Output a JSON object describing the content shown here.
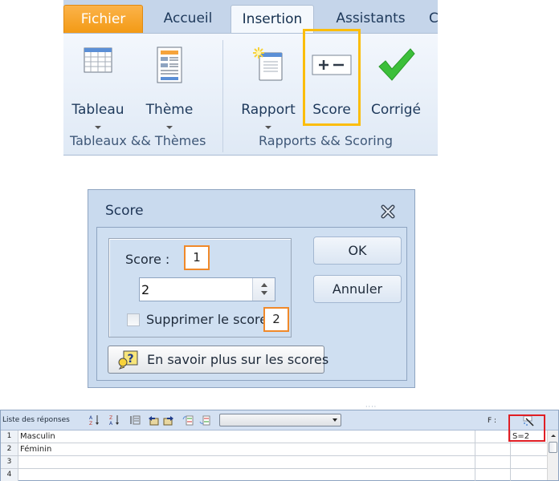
{
  "ribbon": {
    "tabs": [
      {
        "label": "Fichier"
      },
      {
        "label": "Accueil"
      },
      {
        "label": "Insertion"
      },
      {
        "label": "Assistants"
      },
      {
        "label": "C"
      }
    ],
    "active_tab": "Insertion",
    "groups": [
      {
        "label": "Tableaux && Thèmes",
        "buttons": [
          {
            "label": "Tableau",
            "icon": "table-icon",
            "has_dropdown": true
          },
          {
            "label": "Thème",
            "icon": "theme-icon",
            "has_dropdown": true
          }
        ]
      },
      {
        "label": "Rapports && Scoring",
        "buttons": [
          {
            "label": "Rapport",
            "icon": "report-icon",
            "has_dropdown": true
          },
          {
            "label": "Score",
            "icon": "plus-minus-icon",
            "has_dropdown": false,
            "highlighted": true
          },
          {
            "label": "Corrigé",
            "icon": "checkmark-icon",
            "has_dropdown": false
          }
        ]
      }
    ],
    "highlight_color": "#fbbd0b"
  },
  "dialog": {
    "title": "Score",
    "score_label": "Score :",
    "score_value": "2",
    "callout_1": "1",
    "callout_2": "2",
    "suppress_label": "Supprimer le score",
    "suppress_checked": false,
    "ok_label": "OK",
    "cancel_label": "Annuler",
    "help_label": "En savoir plus sur les scores",
    "callout_color": "#f0892a"
  },
  "list": {
    "title": "Liste des réponses",
    "toolbar_icons": [
      "sort-ascending-icon",
      "sort-descending-icon",
      "numbered-list-icon",
      "move-left-icon",
      "move-right-icon",
      "import-icon",
      "export-icon"
    ],
    "combo_value": "",
    "f_label": "F :",
    "score_col_icon": "magic-wand-icon",
    "rows": [
      {
        "num": "1",
        "text": "Masculin",
        "score": "S=2"
      },
      {
        "num": "2",
        "text": "Féminin",
        "score": ""
      },
      {
        "num": "3",
        "text": "",
        "score": ""
      },
      {
        "num": "4",
        "text": "",
        "score": ""
      }
    ],
    "highlight_color": "#e01e24"
  }
}
